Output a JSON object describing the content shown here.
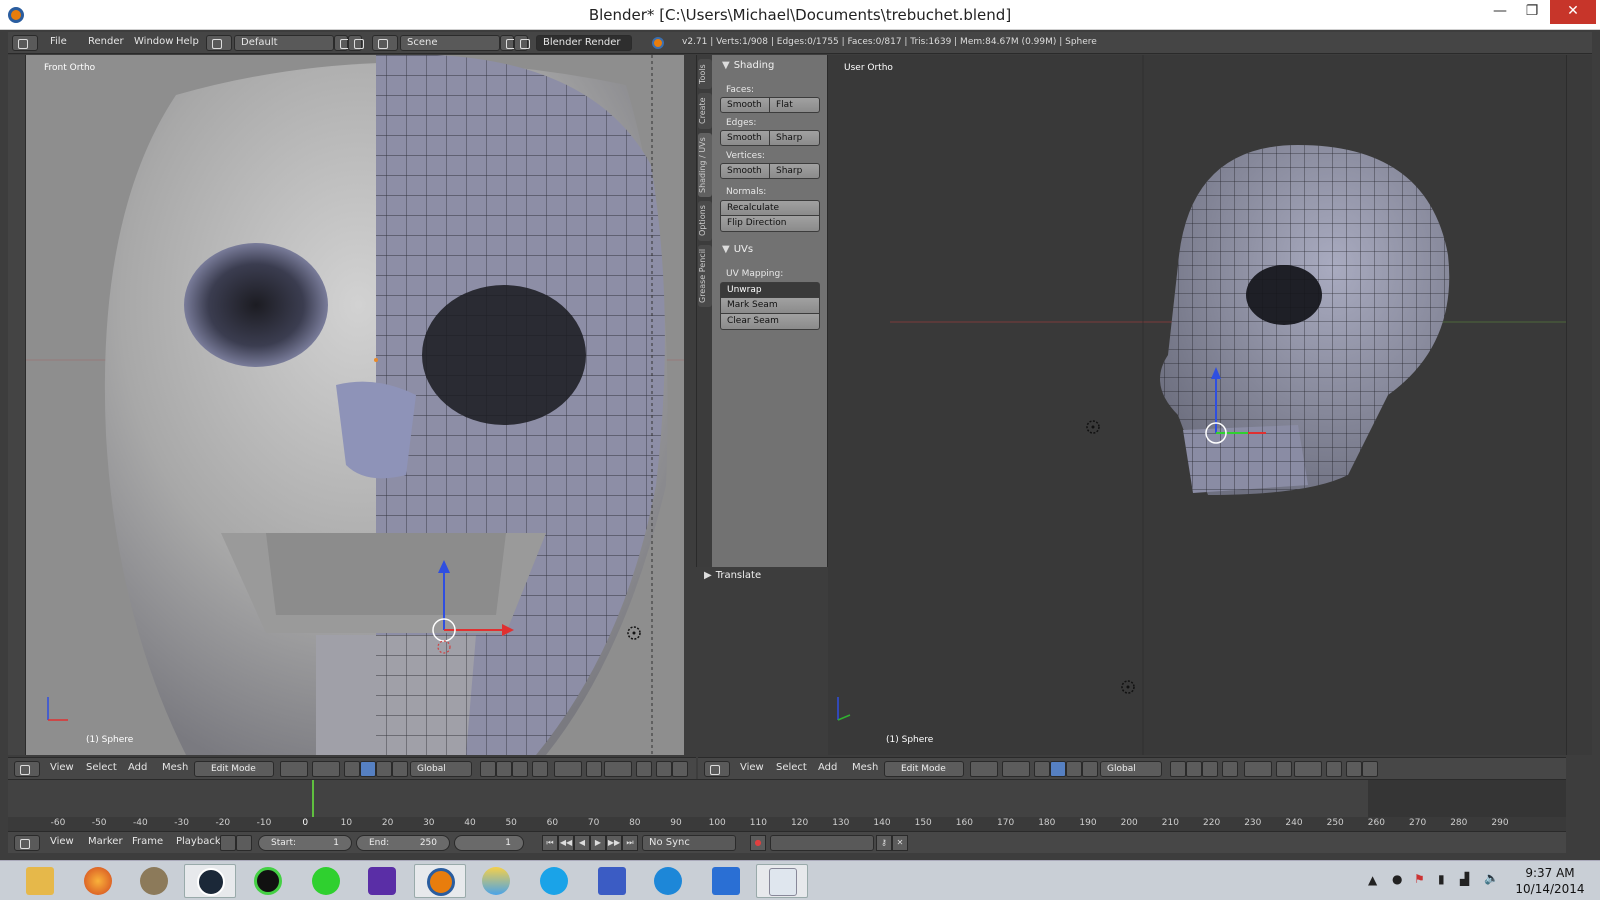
{
  "window": {
    "title": "Blender* [C:\\Users\\Michael\\Documents\\trebuchet.blend]",
    "minimize": "—",
    "maximize": "❐",
    "close": "✕"
  },
  "info_header": {
    "menus": [
      "File",
      "Render",
      "Window",
      "Help"
    ],
    "layout": "Default",
    "scene": "Scene",
    "engine": "Blender Render",
    "stats": "v2.71 | Verts:1/908 | Edges:0/1755 | Faces:0/817 | Tris:1639 | Mem:84.67M (0.99M) | Sphere"
  },
  "viewport_left": {
    "label": "Front Ortho",
    "object": "(1) Sphere"
  },
  "viewport_right": {
    "label": "User Ortho",
    "object": "(1) Sphere"
  },
  "tool_tabs": [
    "Tools",
    "Create",
    "Shading / UVs",
    "Options",
    "Grease Pencil"
  ],
  "shelf": {
    "shading": {
      "title": "Shading",
      "faces_label": "Faces:",
      "faces": [
        "Smooth",
        "Flat"
      ],
      "edges_label": "Edges:",
      "edges": [
        "Smooth",
        "Sharp"
      ],
      "vertices_label": "Vertices:",
      "vertices": [
        "Smooth",
        "Sharp"
      ],
      "normals_label": "Normals:",
      "normals": [
        "Recalculate",
        "Flip Direction"
      ]
    },
    "uvs": {
      "title": "UVs",
      "mapping_label": "UV Mapping:",
      "unwrap": "Unwrap",
      "mark_seam": "Mark Seam",
      "clear_seam": "Clear Seam"
    },
    "translate": "Translate"
  },
  "view_header": {
    "menus": [
      "View",
      "Select",
      "Add",
      "Mesh"
    ],
    "mode": "Edit Mode",
    "orientation": "Global"
  },
  "timeline": {
    "ticks": [
      "-60",
      "-50",
      "-40",
      "-30",
      "-20",
      "-10",
      "0",
      "10",
      "20",
      "30",
      "40",
      "50",
      "60",
      "70",
      "80",
      "90",
      "100",
      "110",
      "120",
      "130",
      "140",
      "150",
      "160",
      "170",
      "180",
      "190",
      "200",
      "210",
      "220",
      "230",
      "240",
      "250",
      "260",
      "270",
      "280",
      "290"
    ],
    "menus": [
      "View",
      "Marker",
      "Frame",
      "Playback"
    ],
    "start_label": "Start:",
    "start": "1",
    "end_label": "End:",
    "end": "250",
    "current": "1",
    "sync": "No Sync"
  },
  "taskbar": {
    "time": "9:37 AM",
    "date": "10/14/2014"
  }
}
